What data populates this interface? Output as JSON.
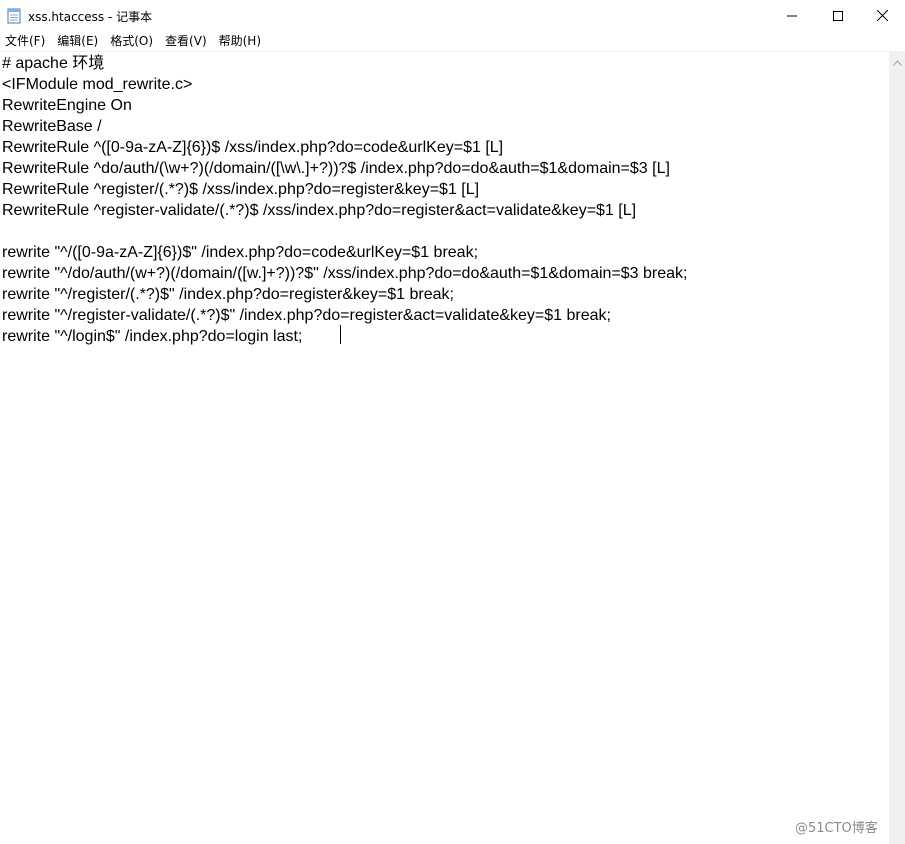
{
  "window": {
    "title": "xss.htaccess - 记事本",
    "icon": "notepad-icon"
  },
  "title_buttons": {
    "minimize": "minimize-icon",
    "maximize": "maximize-icon",
    "close": "close-icon"
  },
  "menu": [
    {
      "label": "文件(F)"
    },
    {
      "label": "编辑(E)"
    },
    {
      "label": "格式(O)"
    },
    {
      "label": "查看(V)"
    },
    {
      "label": "帮助(H)"
    }
  ],
  "editor": {
    "lines": [
      "# apache 环境",
      "<IFModule mod_rewrite.c>",
      "RewriteEngine On",
      "RewriteBase /",
      "RewriteRule ^([0-9a-zA-Z]{6})$ /xss/index.php?do=code&urlKey=$1 [L]",
      "RewriteRule ^do/auth/(\\w+?)(/domain/([\\w\\.]+?))?$ /index.php?do=do&auth=$1&domain=$3 [L]",
      "RewriteRule ^register/(.*?)$ /xss/index.php?do=register&key=$1 [L]",
      "RewriteRule ^register-validate/(.*?)$ /xss/index.php?do=register&act=validate&key=$1 [L]",
      "",
      "rewrite \"^/([0-9a-zA-Z]{6})$\" /index.php?do=code&urlKey=$1 break;",
      "rewrite \"^/do/auth/(w+?)(/domain/([w.]+?))?$\" /xss/index.php?do=do&auth=$1&domain=$3 break;",
      "rewrite \"^/register/(.*?)$\" /index.php?do=register&key=$1 break;",
      "rewrite \"^/register-validate/(.*?)$\" /index.php?do=register&act=validate&key=$1 break;",
      "rewrite \"^/login$\" /index.php?do=login last;"
    ]
  },
  "watermark": "@51CTO博客"
}
